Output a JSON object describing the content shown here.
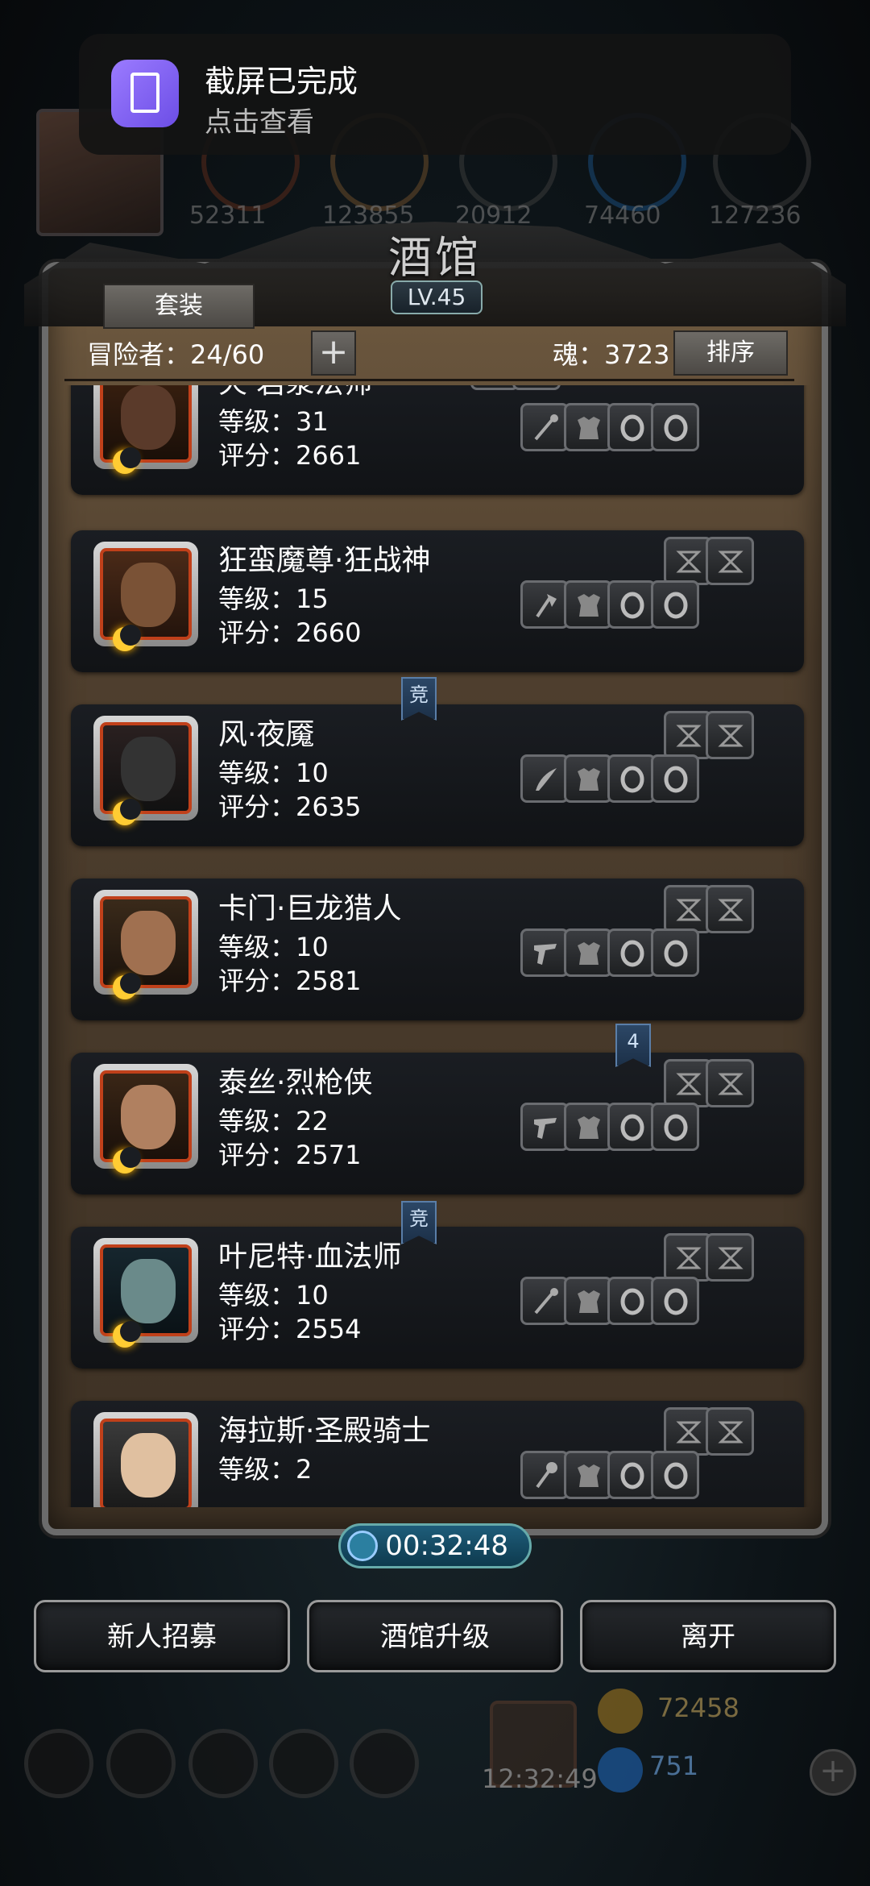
{
  "notification": {
    "title": "截屏已完成",
    "subtitle": "点击查看"
  },
  "top_resources": [
    "52311",
    "123855",
    "20912",
    "74460",
    "127236"
  ],
  "tavern": {
    "title": "酒馆",
    "level": "LV.45",
    "suit_button": "套装",
    "adventurers_label": "冒险者：24/60",
    "soul_label": "魂：3723",
    "sort_button": "排序"
  },
  "heroes": [
    {
      "name": "火·岩浆法师",
      "level": "等级：31",
      "score": "评分：2661",
      "weapon": "staff-icon"
    },
    {
      "name": "狂蛮魔尊·狂战神",
      "level": "等级：15",
      "score": "评分：2660",
      "weapon": "axe-icon"
    },
    {
      "name": "风·夜魇",
      "level": "等级：10",
      "score": "评分：2635",
      "weapon": "sword-icon"
    },
    {
      "name": "卡门·巨龙猎人",
      "level": "等级：10",
      "score": "评分：2581",
      "weapon": "gun-icon"
    },
    {
      "name": "泰丝·烈枪侠",
      "level": "等级：22",
      "score": "评分：2571",
      "weapon": "gun-icon"
    },
    {
      "name": "叶尼特·血法师",
      "level": "等级：10",
      "score": "评分：2554",
      "weapon": "staff-icon"
    },
    {
      "name": "海拉斯·圣殿骑士",
      "level": "等级：2",
      "score": "",
      "weapon": "mace-icon"
    }
  ],
  "markers": [
    "竞",
    "4",
    "竞"
  ],
  "timer": "00:32:48",
  "buttons": {
    "recruit": "新人招募",
    "upgrade": "酒馆升级",
    "leave": "离开"
  },
  "hud": {
    "gift_time": "12:32:49",
    "gold": "72458",
    "gems": "751"
  },
  "colors": {
    "frame_red": "#c0401a",
    "timer_blue": "#1e5d7a",
    "panel_brown": "#4f3f2e"
  }
}
